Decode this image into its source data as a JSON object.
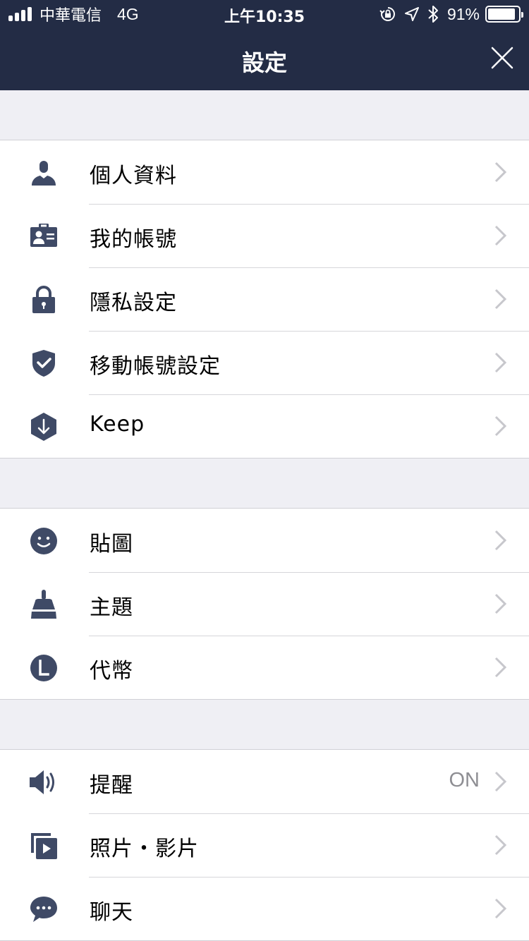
{
  "status_bar": {
    "carrier": "中華電信",
    "network": "4G",
    "time": "上午10:35",
    "battery_percent": "91%",
    "battery_level": 0.91,
    "icons": [
      "signal-icon",
      "orientation-lock-icon",
      "location-arrow-icon",
      "bluetooth-icon",
      "battery-icon"
    ]
  },
  "nav": {
    "title": "設定",
    "close_icon": "close-icon"
  },
  "colors": {
    "nav_background": "#232c45",
    "icon_color": "#3f4a66",
    "page_background": "#efeff4",
    "chevron": "#c7c7cc",
    "value_text": "#8e8e93"
  },
  "sections": [
    {
      "items": [
        {
          "label": "個人資料",
          "icon": "person-icon"
        },
        {
          "label": "我的帳號",
          "icon": "id-card-icon"
        },
        {
          "label": "隱私設定",
          "icon": "lock-icon"
        },
        {
          "label": "移動帳號設定",
          "icon": "shield-check-icon"
        },
        {
          "label": "Keep",
          "icon": "keep-hexagon-icon"
        }
      ]
    },
    {
      "items": [
        {
          "label": "貼圖",
          "icon": "smiley-icon"
        },
        {
          "label": "主題",
          "icon": "brush-icon"
        },
        {
          "label": "代幣",
          "icon": "coin-icon"
        }
      ]
    },
    {
      "items": [
        {
          "label": "提醒",
          "icon": "speaker-icon",
          "value": "ON"
        },
        {
          "label": "照片・影片",
          "icon": "media-icon"
        },
        {
          "label": "聊天",
          "icon": "chat-bubble-icon"
        }
      ]
    }
  ]
}
